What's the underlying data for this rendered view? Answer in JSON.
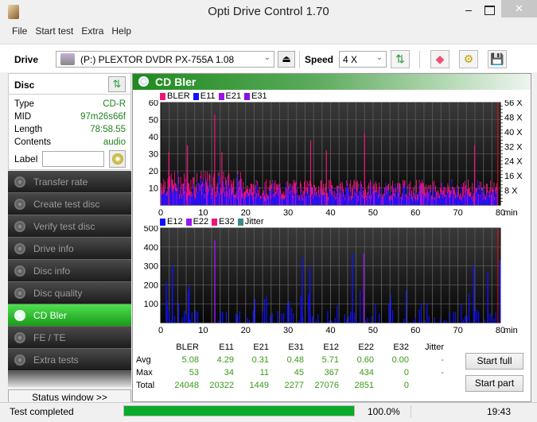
{
  "window": {
    "title": "Opti Drive Control 1.70",
    "minimize": "‒",
    "close": "✕"
  },
  "menu": [
    "File",
    "Start test",
    "Extra",
    "Help"
  ],
  "toolbar": {
    "drive_label": "Drive",
    "drive_value": "(P:)  PLEXTOR DVDR   PX-755A 1.08",
    "speed_label": "Speed",
    "speed_value": "4 X",
    "eject_icon": "⏏",
    "refresh_icon": "⇅",
    "erase_icon": "◆",
    "settings_icon": "⚙",
    "save_icon": "💾"
  },
  "disc": {
    "header": "Disc",
    "rows": [
      {
        "label": "Type",
        "value": "CD-R"
      },
      {
        "label": "MID",
        "value": "97m26s66f"
      },
      {
        "label": "Length",
        "value": "78:58.55"
      },
      {
        "label": "Contents",
        "value": "audio"
      }
    ],
    "label_field": "Label",
    "label_value": ""
  },
  "nav": [
    {
      "label": "Transfer rate",
      "active": false
    },
    {
      "label": "Create test disc",
      "active": false
    },
    {
      "label": "Verify test disc",
      "active": false
    },
    {
      "label": "Drive info",
      "active": false
    },
    {
      "label": "Disc info",
      "active": false
    },
    {
      "label": "Disc quality",
      "active": false
    },
    {
      "label": "CD Bler",
      "active": true
    },
    {
      "label": "FE / TE",
      "active": false
    },
    {
      "label": "Extra tests",
      "active": false
    }
  ],
  "status_window_button": "Status window >>",
  "panel_title": "CD Bler",
  "colors": {
    "BLER": "#f0147a",
    "E11": "#1010ff",
    "E21": "#9a14ee",
    "E31": "#8a10e8",
    "E12": "#1010ff",
    "E22": "#9a14ee",
    "E32": "#f0147a",
    "Jitter": "#3a8a8a",
    "speed_line": "#e01010"
  },
  "chart_data": [
    {
      "type": "bar",
      "title": "BLER / E11 / E21 / E31",
      "legend": [
        "BLER",
        "E11",
        "E21",
        "E31"
      ],
      "xlabel": "min",
      "xlim": [
        0,
        80
      ],
      "x_ticks": [
        "0",
        "10",
        "20",
        "30",
        "40",
        "50",
        "60",
        "70",
        "80"
      ],
      "ylim": [
        0,
        60
      ],
      "y_ticks": [
        "10",
        "20",
        "30",
        "40",
        "50",
        "60"
      ],
      "y2_ticks": [
        "8 X",
        "16 X",
        "24 X",
        "32 X",
        "40 X",
        "48 X",
        "56 X"
      ],
      "peaks": [
        {
          "x": 1.8,
          "BLER": 31
        },
        {
          "x": 6.2,
          "BLER": 35
        },
        {
          "x": 12.6,
          "BLER": 53
        },
        {
          "x": 14.3,
          "BLER": 31
        },
        {
          "x": 35.2,
          "BLER": 38
        },
        {
          "x": 38.9,
          "BLER": 32
        },
        {
          "x": 47.9,
          "BLER": 42
        },
        {
          "x": 73.8,
          "BLER": 35
        }
      ],
      "typical_level": {
        "BLER": 12,
        "E11": 8
      }
    },
    {
      "type": "bar",
      "title": "E12 / E22 / E32 / Jitter",
      "legend": [
        "E12",
        "E22",
        "E32",
        "Jitter"
      ],
      "xlabel": "min",
      "xlim": [
        0,
        80
      ],
      "x_ticks": [
        "0",
        "10",
        "20",
        "30",
        "40",
        "50",
        "60",
        "70",
        "80"
      ],
      "ylim": [
        0,
        500
      ],
      "y_ticks": [
        "100",
        "200",
        "300",
        "400",
        "500"
      ],
      "peaks": [
        {
          "x": 1.2,
          "E12": 215
        },
        {
          "x": 2.6,
          "E12": 305
        },
        {
          "x": 6.5,
          "E12": 195
        },
        {
          "x": 12.6,
          "E22": 434
        },
        {
          "x": 33.2,
          "E12": 345
        },
        {
          "x": 35.0,
          "E12": 295
        },
        {
          "x": 45.0,
          "E12": 367
        },
        {
          "x": 47.7,
          "E22": 365
        },
        {
          "x": 73.6,
          "E12": 305
        },
        {
          "x": 76.9,
          "E12": 265
        },
        {
          "x": 79.8,
          "E12": 330
        }
      ]
    }
  ],
  "stats": {
    "columns": [
      "BLER",
      "E11",
      "E21",
      "E31",
      "E12",
      "E22",
      "E32",
      "Jitter"
    ],
    "rows": [
      {
        "label": "Avg",
        "values": [
          "5.08",
          "4.29",
          "0.31",
          "0.48",
          "5.71",
          "0.60",
          "0.00",
          "-"
        ]
      },
      {
        "label": "Max",
        "values": [
          "53",
          "34",
          "11",
          "45",
          "367",
          "434",
          "0",
          "-"
        ]
      },
      {
        "label": "Total",
        "values": [
          "24048",
          "20322",
          "1449",
          "2277",
          "27076",
          "2851",
          "0",
          ""
        ]
      }
    ]
  },
  "buttons": {
    "start_full": "Start full",
    "start_part": "Start part"
  },
  "statusbar": {
    "text": "Test completed",
    "progress": 100.0,
    "progress_label": "100.0%",
    "time": "19:43"
  }
}
